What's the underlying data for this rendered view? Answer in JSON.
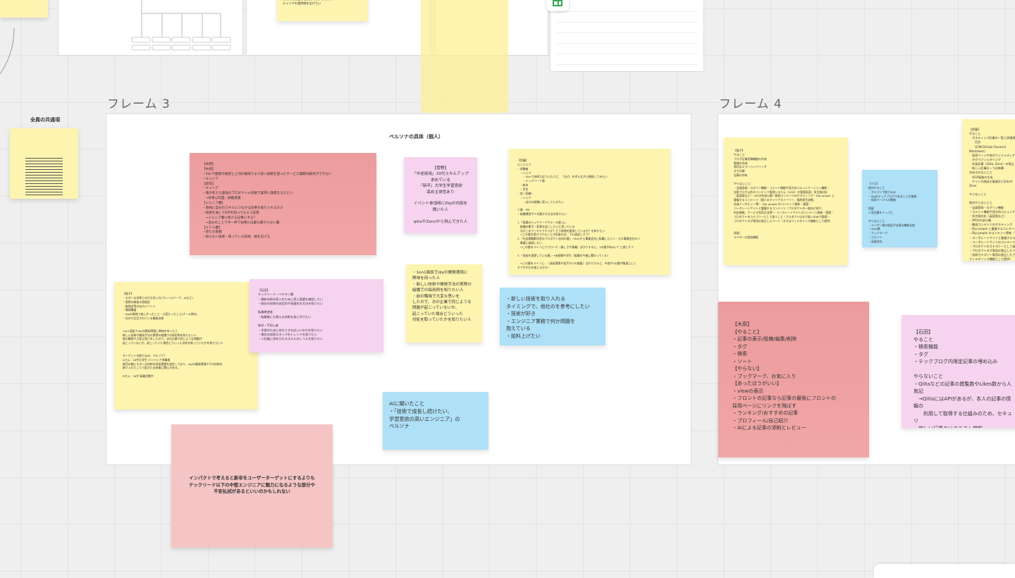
{
  "frames": {
    "frame3_label": "フレーム 3",
    "frame4_label": "フレーム 4",
    "frame3_title": "ペルソナの具体（個人）",
    "common_label": "全員の共通項"
  },
  "top": {
    "note": "技術的な面白さと魅力的な体制を知り\nキャリアの選択肢を広げたい"
  },
  "stickies": {
    "kihara": "【木原】\n【中途】\n・SIerで顧客の要望と上司の権限でより良い技術を使ったサービス課題の解決ができない\n・キャリア\n【新卒】\n・キャリア\n・僕の考えた最強のプロダクトor技術で業界に激震を与えたい\n　→好奇心旺盛、挑戦意識\n【ジュニア層】\n・単純に自分のスキルにつながる記事を取り入れるだけ\n・技術を通してDIPを知ってもらう段階\n　→ジュニア層に受ける記事にする？\n　→自分のことで手一杯で採用には最も繋がらない層\n【ミドル層】\n・新たな挑戦\n・知らない技術・知っている技術、幅を広げる",
    "kanno": "【菅野】\n「中途採用」20代スキルアップ\n求めている\n「新卒」大学生学習意欲\n高め主体性あり\n\nイベント参加時にDipの内容を\n聞いた人\n\nqiitaやZennから飛んできた人",
    "ito": "【伊藤】\nエンジニア\n・求職者\n　・シニア\n　　・SIerで技術力はついたけど、「なぜ」を考えながら開発してみたい\n　　・テックリード層\n　・新卒\n　・学生\n・他（同僚）\n　・シニア\n　　・自分の組織に導入していきたい\n\n人事・PM\n・組織運営や人を動かす方法を知りたい\n\n1.「現場のテックリードやエース層 ◎」\n　組織の牽引・変革を起こしたいと思っている\n　なぜこのアーキテクチャか？どう負債を解消しているか？を知りたい\n　→この層を惹きつけることが出来れば、下も追従しそう？\n2.「社会課題解決型のプロダクト志向の層」→SIerから事業会社に転職したい人・元々事業会社の人\n　事業に貢献したい\n　→この層をメインにアプローチ（楽しさや意義）ばかりすると、1の層がぬるい？と感じそう\n\n3.「成長を渇望している層」→未経験や学生（組織の今後に関わってくる）\n\n　→この層をメインに...（成長環境や若手からの裁量）ばかりすると、中途や1の層が敬遠しにく\nそうやずれを感じるかも？",
    "neko": "【猫子】\n・モダンな技術との付き合い方(フレームワーク、AIなど)\n・実際の開発の雰囲気\n・勉強会等の社内イベント\n・開発機器\n・dipの開発で楽しかったこと・大変だったこと(チーム単位)\n・社内で注目されている最新技術\n\n\n1on1面談でdipの開発環境に興味を持った人\n新しい技術や開発手法の実際の組織での採用例を知りたい人\n前の職場で大変な思いをしたので、次の企業で同じような問題が\n起こっていないか、起こっていた場合どういった対処を取っていたかを知りたい人\n\n\nターゲットの絞り込み、ペルソナ？\nAさん：20代大学生 エンジニア求職者\n就活の軸にモダンな技術の採用実績を設定しており、dipの開発環境やその技術を\n取り入れたことで起きた出来事に関心がある。\n\nBさん：30代 転職活動中",
    "ishida3": "【石田】\nテックリード・ベテラン層\n・最新技術の導入のために導入実績を確認したい\n・既存の技術の安定化や高速化の方法を知りたい\n\n転職希望者\n・転職後にも使える技術を身に付けたい\n\n新卒・IT初心者\n・学習のために何からすればいいのかを知りたい\n・現在の技術スタックのトレンドを知りたい\n・入社後に求められるスキルのレベルを知りたい",
    "oneonone": "・1on1面談でdipの開発環境に\n興味を持った人\n・新しい技術や開発手法の実際の\n組織での採用例を知りたい人\n・前の職場で大変な思いを\nしたので、次の企業で同じような\n問題が起こっていないか、\n起こっていた場合どういった\n対処を取っていたかを知りたい人",
    "newtech": "・新しい技術を取り入れる\nタイミングで、他社のを参考にしたい\n・技術が好き\n・エンジニア業務で何か問題を\n抱えている\n・給料上げたい",
    "ai": "AIに聞いたこと\n・「技術で成長し続けたい、\n学習意欲の高いエンジニア」の\nペルソナ",
    "impact": "インパクトで考えると新卒をユーザーターゲットにするよりも\nテックリード以下の中堅エンジニアに魅力になるような部分や\n不安払拭があるといいのかもしれない",
    "neko4": "【猫子】\nやること：\nブログ記事投稿機能の作成\n数値の作成\n適切なエラーハンドリング\nタグ分類\n記事の共有\n\nやらないこと：\n・会員登録・ログイン機能・コメント機能や双方向コミュニケーション機能・\n技術ブログ以外のコンテンツ管理システム（CMS）の管理画面・多言語対応\n（英語版など）・APIの外部公開・動画コンテンツのホスティング・Dip people と\n重複するコンテンツ（個人のキャリアストーリー、福利厚生詳細、\n社員インタビュー等）・Dip people のコンテンツ更新・管理・\nコーポレートサイトと重複するコンテンツ（プロダクトの一般向け紹介、\n料金情報、サービス利用方法等）・コーポレートサイトのコンテンツ更新・管理・\nプロダクトをカテゴリーとして扱うこと（プロダクトはタグ扱いのみで管理）・\nプロダクトタグ専用の独立したページ（タグはフィルタリング機能として提供）\n\n\n保留：\nライターの追加機能",
    "blue4": "【クス】\n絶対やること\n・カテゴリで絞り込み\n・dipのテックブログであることの強調\n・採用ページへの動線\n\n保留\n人気記事をトップに\n\nやらないこと\n・ユーザー側の認証が必要な機能全般\n・view数\n・ブックマーク\n・コメント\n・英語対応",
    "ito4": "【伊藤】\nやること\n　ホスティング記事の一覧と詳細表示\n　　目次\n　　GFM(GitHub Flavored Markdown)\n　採用ページや他オウンドメディア\n　タグでフィルタリング\n　外部記事（Qiita, Zenn）の独立\n　新しい記事を一つは執筆\n決めるのないこと\n　OGP画像の生成\n　サイト内独自の著者QとQiitaやZenn\n\nやらないこと\n\n絶対やらないこと\n・会員登録・ログイン機能\n・コメント機能や双方向コミュニケ\n・多言語対応（英語版など）\n・APIの外部公開\n・動画コンテンツのホスティング\n・Dip people と重複するコンテンツ\n・Dip people のコンテンツ更新・管\n・コーポレートサイトと重複するコ\n・コーポレートサイトのコンテンツ\n・プロダクトをカテゴリーとして扱\n・プロダクトタグ専用の独立したペ\n・技術カテゴリー専用の独立したナ\nフィルタリング機能として提供）\n・外部記事（Zenn/Qiita）の全文表",
    "kihara4": "【木原】\n【やること】\n・記事の表示/投稿/編集/削除\n・タグ\n・検索\n・ソート\n【やらない】\n・ブックマーク、お気に入り\n【あったほうがいい】\n・viewの表示\n・フロントの記事なら記事の最後にフロントの\n採用ページにリンクを飛ばす\n・ランキング/おすすめの記事\n・プロフィール/自己紹介\n・AIによる記事の添削とレビュー",
    "ishida4": "【石田】\nやること\n・検索機能\n・タグ\n・テックブログ内限定記事の埋め込み\n\nやらないこと\n・Qiitaなどの記事の閲覧数やLikes数から人気記\n　→QiitaにはAPIがあるが、本人の記事の情報の\n　　利用して取得する仕組みのため、セキュリ\n・欲しい記事のリクエスト機能\n　→リクエストが放置された場合に印象が悪く\n・コメント機能"
  },
  "colors": {
    "yellow": "#fdf4b0",
    "red": "#ec9c9c",
    "pink": "#f6d3ef",
    "blue": "#aee0f7",
    "light_red": "#f5c5c5",
    "canvas": "#efefef"
  }
}
